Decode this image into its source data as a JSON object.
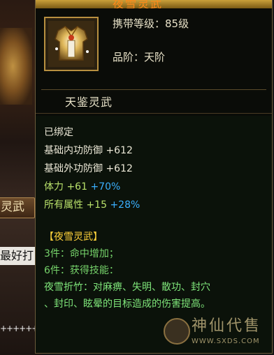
{
  "backdrop": {
    "banner_label": "灵武",
    "snippet_text": "最好打",
    "plus_text": "++++++++"
  },
  "tooltip": {
    "title_partial": "夜雪灵武",
    "icon": "armor-icon",
    "required_level": "携带等级：85级",
    "grade": "品阶：天阶",
    "item_name": "天鉴灵武",
    "bound": "已绑定",
    "stats": {
      "inner_def_label": "基础内功防御",
      "inner_def_value": "+612",
      "outer_def_label": "基础外功防御",
      "outer_def_value": "+612",
      "stamina_label": "体力",
      "stamina_value": "+61",
      "stamina_pct": "+70%",
      "all_attr_label": "所有属性",
      "all_attr_value": "+15",
      "all_attr_pct": "+28%"
    },
    "set": {
      "name": "【夜雪灵武】",
      "bonus3": "3件：命中增加；",
      "bonus6": "6件：获得技能：",
      "skill_line1": "夜雪折竹：对麻痹、失明、散功、封穴",
      "skill_line2": "、封印、眩晕的目标造成的伤害提高。"
    }
  },
  "watermark": {
    "name": "神仙代售",
    "url": "WWW.SXDS.COM"
  },
  "colors": {
    "panel_bg": "#0b120a",
    "text": "#ebe7d6",
    "stat_green": "#b8e06a",
    "pct_blue": "#3ab0ff",
    "set_gold": "#ffd23a",
    "set_green": "#76d36a"
  }
}
